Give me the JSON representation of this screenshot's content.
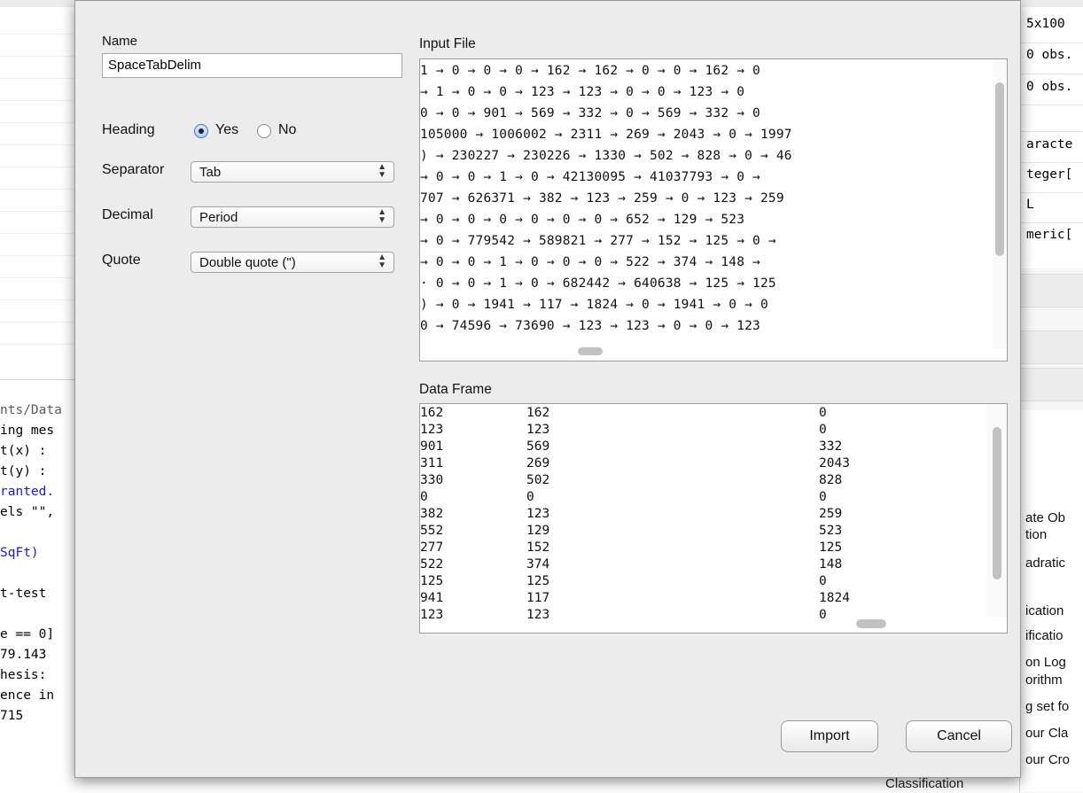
{
  "background": {
    "console_lines": [
      {
        "text": "nts/Data",
        "style": "gray"
      },
      {
        "text": "ing mes",
        "style": "normal"
      },
      {
        "text": "t(x) :",
        "style": "normal"
      },
      {
        "text": "t(y) :",
        "style": "normal"
      },
      {
        "text": "ranted.",
        "style": "blue"
      },
      {
        "text": "els \"\",",
        "style": "normal"
      },
      {
        "text": "",
        "style": "normal"
      },
      {
        "text": "SqFt)",
        "style": "blue"
      },
      {
        "text": "",
        "style": "normal"
      },
      {
        "text": " t-test",
        "style": "normal"
      },
      {
        "text": "",
        "style": "normal"
      },
      {
        "text": "e == 0]",
        "style": "normal"
      },
      {
        "text": " 79.143",
        "style": "normal"
      },
      {
        "text": "hesis:",
        "style": "normal"
      },
      {
        "text": "ence in",
        "style": "normal"
      },
      {
        "text": "715",
        "style": "normal"
      }
    ],
    "env_lines": [
      "5x100",
      "0 obs.",
      "0 obs.",
      "aracte",
      "teger[",
      "L",
      "meric["
    ],
    "help_lines": [
      "ate Ob",
      "tion",
      "adratic",
      "ication",
      "ificatio",
      "on Log",
      "orithm",
      "g set fo",
      "our Cla",
      "our Cro"
    ],
    "bottom_text": "Classification"
  },
  "dialog": {
    "name_label": "Name",
    "name_value": "SpaceTabDelim",
    "heading_label": "Heading",
    "heading_yes": "Yes",
    "heading_no": "No",
    "heading_selected": "Yes",
    "separator_label": "Separator",
    "separator_value": "Tab",
    "decimal_label": "Decimal",
    "decimal_value": "Period",
    "quote_label": "Quote",
    "quote_value": "Double quote (\")",
    "input_file_label": "Input File",
    "input_lines": [
      "1 → 0 → 0 → 0 → 162 → 162 → 0 → 0 → 162 → 0",
      " → 1 → 0 → 0 → 123 → 123 → 0 → 0 → 123 → 0",
      "0 → 0 → 901 → 569 → 332 → 0 → 569 → 332 → 0",
      "105000 → 1006002 → 2311 → 269 → 2043 → 0 → 1997",
      ") → 230227 → 230226 → 1330 → 502 → 828 → 0 → 46",
      " → 0 → 0 → 1 → 0 → 42130095 → 41037793 → 0 →",
      "707 → 626371 → 382 → 123 → 259 → 0 → 123 → 259",
      " → 0 → 0 → 0 → 0 → 0 → 0 → 652 → 129 → 523",
      " → 0 → 779542 → 589821 → 277 → 152 → 125 → 0 →",
      "→ 0 → 0 → 1 → 0 → 0 → 0 → 522 → 374 → 148 →",
      "· 0 → 0 → 1 → 0 → 682442 → 640638 → 125 → 125",
      ") → 0 → 1941 → 117 → 1824 → 0 → 1941 → 0 → 0",
      " 0 → 74596 → 73690 → 123 → 123 → 0 → 0 → 123"
    ],
    "data_frame_label": "Data Frame",
    "data_rows": [
      [
        "162",
        "162",
        "0"
      ],
      [
        "123",
        "123",
        "0"
      ],
      [
        "901",
        "569",
        "332"
      ],
      [
        "311",
        "269",
        "2043"
      ],
      [
        "330",
        "502",
        "828"
      ],
      [
        "0",
        "0",
        "0"
      ],
      [
        "382",
        "123",
        "259"
      ],
      [
        "552",
        "129",
        "523"
      ],
      [
        "277",
        "152",
        "125"
      ],
      [
        "522",
        "374",
        "148"
      ],
      [
        "125",
        "125",
        "0"
      ],
      [
        "941",
        "117",
        "1824"
      ],
      [
        "123",
        "123",
        "0"
      ]
    ],
    "import_label": "Import",
    "cancel_label": "Cancel"
  }
}
